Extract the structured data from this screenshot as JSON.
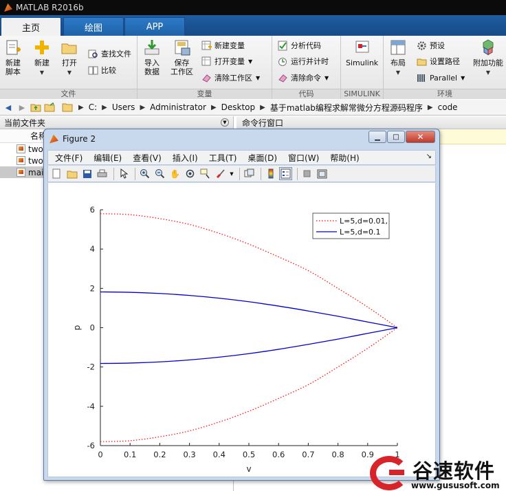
{
  "window": {
    "title": "MATLAB R2016b"
  },
  "tabs": [
    {
      "label": "主页",
      "active": true
    },
    {
      "label": "绘图",
      "active": false
    },
    {
      "label": "APP",
      "active": false
    }
  ],
  "ribbon": {
    "file": {
      "label": "文件",
      "new_script": "新建\n脚本",
      "new_script_l1": "新建",
      "new_script_l2": "脚本",
      "new": "新建",
      "open": "打开",
      "find_files": "查找文件",
      "compare": "比较"
    },
    "variable": {
      "label": "变量",
      "import_l1": "导入",
      "import_l2": "数据",
      "save_l1": "保存",
      "save_l2": "工作区",
      "new_var": "新建变量",
      "open_var": "打开变量",
      "clear_ws": "清除工作区"
    },
    "code": {
      "label": "代码",
      "analyze": "分析代码",
      "run_time": "运行并计时",
      "clear_cmd": "清除命令"
    },
    "simulink": {
      "label": "SIMULINK",
      "button": "Simulink"
    },
    "environment": {
      "label": "环境",
      "layout": "布局",
      "prefs": "预设",
      "set_path": "设置路径",
      "parallel": "Parallel",
      "addons": "附加功能"
    }
  },
  "address": {
    "crumbs": [
      "C:",
      "Users",
      "Administrator",
      "Desktop",
      "基于matlab编程求解常微分方程源码程序",
      "code"
    ]
  },
  "current_folder": {
    "title": "当前文件夹",
    "col_name": "名称",
    "files": [
      {
        "name": "two",
        "selected": false
      },
      {
        "name": "two",
        "selected": false
      },
      {
        "name": "mai",
        "selected": true
      }
    ]
  },
  "command_window": {
    "title": "命令行窗口"
  },
  "figure": {
    "title": "Figure 2",
    "menu": [
      "文件(F)",
      "编辑(E)",
      "查看(V)",
      "插入(I)",
      "工具(T)",
      "桌面(D)",
      "窗口(W)",
      "帮助(H)"
    ],
    "toolbar_icons": [
      "new-figure-icon",
      "open-icon",
      "save-icon",
      "print-icon",
      "pointer-icon",
      "zoom-in-icon",
      "zoom-out-icon",
      "pan-icon",
      "rotate-icon",
      "data-cursor-icon",
      "brush-icon",
      "link-icon",
      "colorbar-icon",
      "legend-icon",
      "hide-plot-tools-icon",
      "show-plot-tools-icon"
    ]
  },
  "chart_data": {
    "type": "line",
    "xlabel": "v",
    "ylabel": "p",
    "xlim": [
      0,
      1
    ],
    "ylim": [
      -6,
      6
    ],
    "xticks": [
      "0",
      "0.1",
      "0.2",
      "0.3",
      "0.4",
      "0.5",
      "0.6",
      "0.7",
      "0.8",
      "0.9",
      "1"
    ],
    "yticks": [
      "6",
      "4",
      "2",
      "0",
      "-2",
      "-4",
      "-6"
    ],
    "grid": false,
    "legend_position": "top-right",
    "x": [
      0,
      0.1,
      0.2,
      0.3,
      0.4,
      0.5,
      0.6,
      0.7,
      0.8,
      0.9,
      1.0
    ],
    "series": [
      {
        "name": "L=5,d=0.01,",
        "style": "dotted",
        "color": "#ff0000",
        "values": [
          5.8,
          5.75,
          5.55,
          5.25,
          4.8,
          4.25,
          3.6,
          2.9,
          2.0,
          1.05,
          0
        ]
      },
      {
        "name": "L=5,d=0.01,",
        "style": "dotted",
        "color": "#ff0000",
        "values": [
          -5.8,
          -5.75,
          -5.55,
          -5.25,
          -4.8,
          -4.25,
          -3.6,
          -2.9,
          -2.0,
          -1.05,
          0
        ]
      },
      {
        "name": "L=5,d=0.1",
        "style": "solid",
        "color": "#0000cc",
        "values": [
          1.82,
          1.8,
          1.74,
          1.64,
          1.5,
          1.32,
          1.1,
          0.85,
          0.58,
          0.29,
          0
        ]
      },
      {
        "name": "L=5,d=0.1",
        "style": "solid",
        "color": "#0000cc",
        "values": [
          -1.82,
          -1.8,
          -1.74,
          -1.64,
          -1.5,
          -1.32,
          -1.1,
          -0.85,
          -0.58,
          -0.29,
          0
        ]
      }
    ],
    "legend": [
      {
        "label": "L=5,d=0.01,",
        "style": "dotted",
        "color": "#ff0000"
      },
      {
        "label": "L=5,d=0.1",
        "style": "solid",
        "color": "#0000cc"
      }
    ]
  },
  "watermark": {
    "brand": "谷速软件",
    "url": "www.gususoft.com"
  }
}
